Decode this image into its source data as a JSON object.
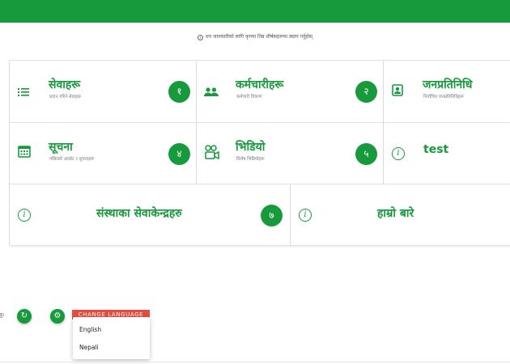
{
  "hint_text": "थप जानकारीको लागि कृपया तिन्न शीर्षकहरूमा ठ्याप गर्नुहोस्",
  "cards": [
    {
      "title": "सेवाहरू",
      "subtitle": "प्रदान गरिने सेवाहरू",
      "badge": "१",
      "icon": "list-icon"
    },
    {
      "title": "कर्मचारीहरू",
      "subtitle": "कर्मचारी विवरण",
      "badge": "२",
      "icon": "people-icon"
    },
    {
      "title": "जनप्रतिनिधि",
      "subtitle": "निर्वाचित जनप्रतिनिधिहरू",
      "badge": "",
      "icon": "contact-icon"
    },
    {
      "title": "सूचना",
      "subtitle": "पछिल्लो अपडेट र सूचनाहरू",
      "badge": "४",
      "icon": "calendar-icon"
    },
    {
      "title": "भिडियो",
      "subtitle": "विशेष भिडियोहरू",
      "badge": "५",
      "icon": "video-icon"
    },
    {
      "title": "test",
      "subtitle": "",
      "badge": "",
      "icon": "info-icon"
    },
    {
      "title": "संस्थाका सेवाकेन्द्रहरु",
      "subtitle": "",
      "badge": "७",
      "icon": "info-icon"
    },
    {
      "title": "हाम्रो बारे",
      "subtitle": "",
      "badge": "",
      "icon": "info-icon"
    }
  ],
  "left_fragment": "हु।",
  "language_button": "CHANGE LANGUAGE",
  "language_menu": [
    "English",
    "Nepali"
  ],
  "colors": {
    "primary": "#169a3b",
    "accent": "#e84b3c"
  }
}
